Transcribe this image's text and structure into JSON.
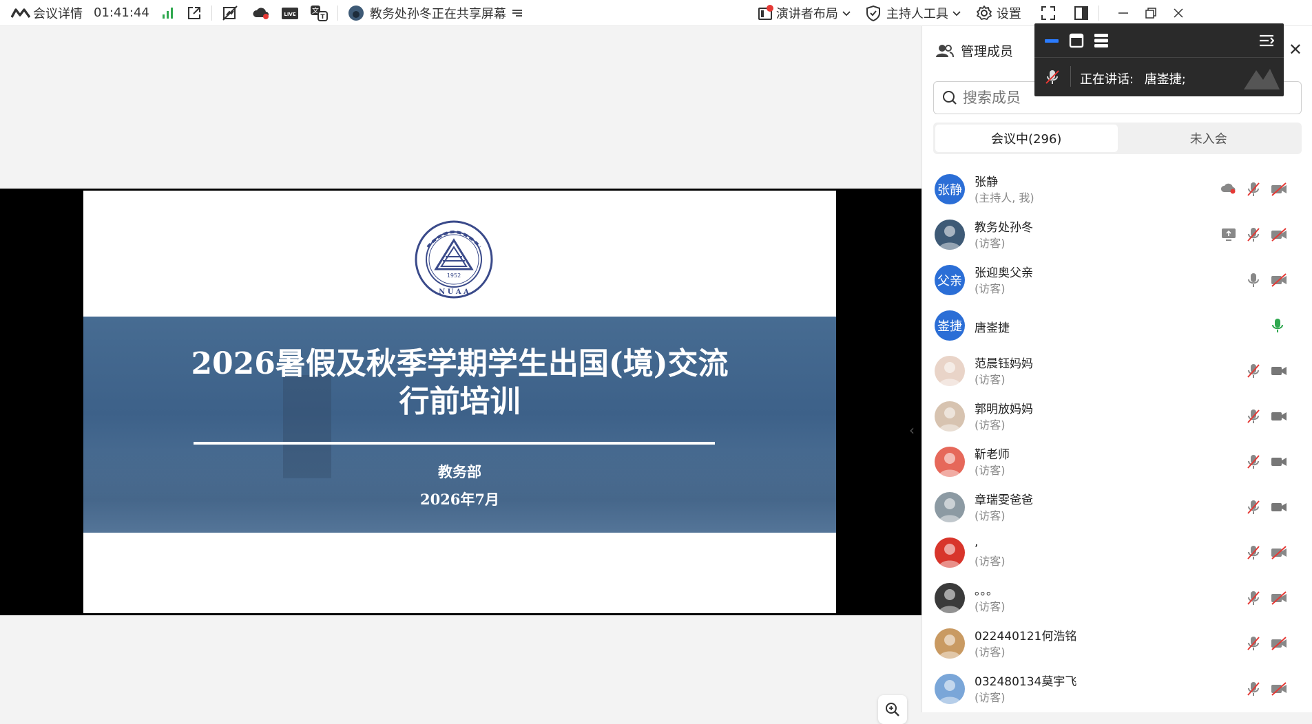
{
  "topbar": {
    "meeting_details": "会议详情",
    "elapsed_time": "01:41:44",
    "sharing_status": "教务处孙冬正在共享屏幕",
    "presenter_layout": "演讲者布局",
    "host_tools": "主持人工具",
    "settings": "设置"
  },
  "slide": {
    "title_line1": "2026暑假及秋季学期学生出国(境)交流",
    "title_line2": "行前培训",
    "department": "教务部",
    "date": "2026年7月",
    "logo_year": "1952",
    "logo_letters": "N U A A"
  },
  "panel": {
    "title": "管理成员",
    "search_placeholder": "搜索成员",
    "tab_in_meeting": "会议中(296)",
    "tab_not_joined": "未入会"
  },
  "floating": {
    "speaking_label": "正在讲话:",
    "speaking_name": "唐崟捷;"
  },
  "members": [
    {
      "name": "张静",
      "role": "(主持人, 我)",
      "avatar_text": "张静",
      "avatar_color": "#2b6ed6",
      "mic": "muted",
      "cam": "off",
      "extra": "cloud-record-icon"
    },
    {
      "name": "教务处孙冬",
      "role": "(访客)",
      "avatar_text": "",
      "avatar_color": "#3e5a76",
      "mic": "muted",
      "cam": "off",
      "extra": "screen-share-icon"
    },
    {
      "name": "张迎奥父亲",
      "role": "(访客)",
      "avatar_text": "父亲",
      "avatar_color": "#2b6ed6",
      "mic": "on",
      "cam": "off",
      "extra": ""
    },
    {
      "name": "唐崟捷",
      "role": "",
      "avatar_text": "崟捷",
      "avatar_color": "#2b6ed6",
      "mic": "speaking",
      "cam": "none",
      "extra": ""
    },
    {
      "name": "范晨钰妈妈",
      "role": "(访客)",
      "avatar_text": "",
      "avatar_color": "#e9d4c8",
      "mic": "muted",
      "cam": "on",
      "extra": ""
    },
    {
      "name": "郭明放妈妈",
      "role": "(访客)",
      "avatar_text": "",
      "avatar_color": "#d7c3b0",
      "mic": "muted",
      "cam": "on",
      "extra": ""
    },
    {
      "name": "靳老师",
      "role": "(访客)",
      "avatar_text": "",
      "avatar_color": "#e6685a",
      "mic": "muted",
      "cam": "on",
      "extra": ""
    },
    {
      "name": "章瑞雯爸爸",
      "role": "(访客)",
      "avatar_text": "",
      "avatar_color": "#8c9aa3",
      "mic": "muted",
      "cam": "on",
      "extra": ""
    },
    {
      "name": ",",
      "role": "(访客)",
      "avatar_text": "",
      "avatar_color": "#d8352b",
      "mic": "muted",
      "cam": "off",
      "extra": ""
    },
    {
      "name": "。。。",
      "role": "(访客)",
      "avatar_text": "",
      "avatar_color": "#3a3a3a",
      "mic": "muted",
      "cam": "off",
      "extra": ""
    },
    {
      "name": "022440121何浩铭",
      "role": "(访客)",
      "avatar_text": "",
      "avatar_color": "#c99a62",
      "mic": "muted",
      "cam": "off",
      "extra": ""
    },
    {
      "name": "032480134莫宇飞",
      "role": "(访客)",
      "avatar_text": "",
      "avatar_color": "#7aa6d8",
      "mic": "muted",
      "cam": "off",
      "extra": ""
    }
  ]
}
